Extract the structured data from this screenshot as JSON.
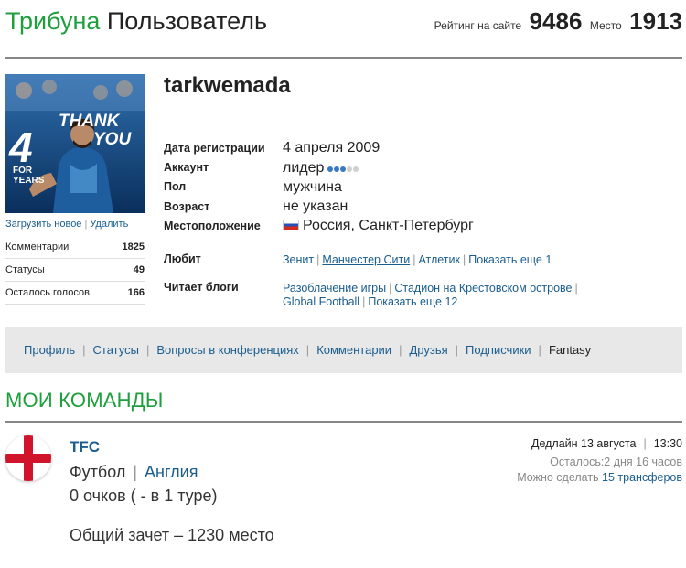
{
  "header": {
    "brand_name": "Трибуна",
    "section_name": "Пользователь",
    "rating_label": "Рейтинг на сайте",
    "rating_value": "9486",
    "place_label": "Место",
    "place_value": "1913"
  },
  "avatar": {
    "banner_line1": "THANK",
    "banner_line2": "YOU",
    "banner_number": "4",
    "banner_for": "FOR",
    "banner_years": "YEARS",
    "upload_label": "Загрузить новое",
    "delete_label": "Удалить"
  },
  "stats": [
    {
      "label": "Комментарии",
      "value": "1825"
    },
    {
      "label": "Статусы",
      "value": "49"
    },
    {
      "label": "Осталось голосов",
      "value": "166"
    }
  ],
  "profile": {
    "username": "tarkwemada",
    "registration_label": "Дата регистрации",
    "registration_value": "4 апреля 2009",
    "account_label": "Аккаунт",
    "account_value": "лидер",
    "account_level": 3,
    "account_level_max": 5,
    "gender_label": "Пол",
    "gender_value": "мужчина",
    "age_label": "Возраст",
    "age_value": "не указан",
    "location_label": "Местоположение",
    "location_value": "Россия, Санкт-Петербург",
    "likes_label": "Любит",
    "likes": [
      "Зенит",
      "Манчестер Сити",
      "Атлетик"
    ],
    "likes_more": "Показать еще 1",
    "blogs_label": "Читает блоги",
    "blogs_line1": [
      "Разоблачение игры",
      "Стадион на Крестовском острове"
    ],
    "blogs_line2": [
      "Global Football"
    ],
    "blogs_more": "Показать еще 12"
  },
  "tabs": [
    "Профиль",
    "Статусы",
    "Вопросы в конференциях",
    "Комментарии",
    "Друзья",
    "Подписчики",
    "Fantasy"
  ],
  "teams": {
    "title": "МОИ КОМАНДЫ",
    "team_name": "TFC",
    "sport": "Футбол",
    "country": "Англия",
    "points": "0 очков ( - в 1 туре)",
    "overall": "Общий зачет – 1230 место",
    "deadline_label": "Дедлайн 13 августа",
    "deadline_time": "13:30",
    "remaining": "Осталось:2 дня 16 часов",
    "transfers_label": "Можно сделать",
    "transfers_value": "15 трансферов"
  },
  "colors": {
    "brand_green": "#1c9f3c",
    "link_blue": "#1a5d8f",
    "tab_bar": "#e8e8e8"
  }
}
